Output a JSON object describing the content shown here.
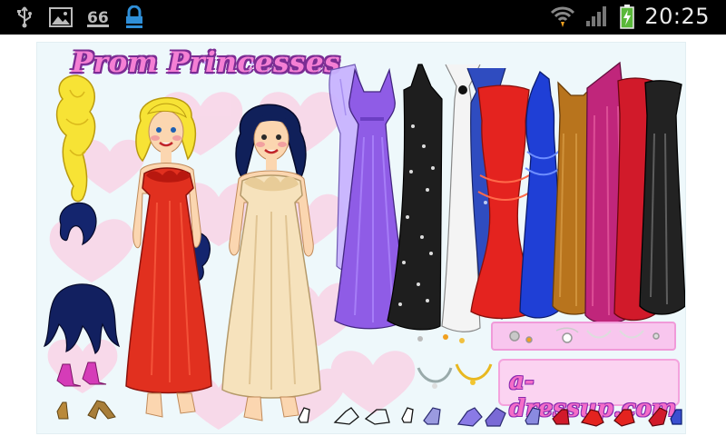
{
  "status_bar": {
    "time": "20:25",
    "left_icons": [
      "usb-icon",
      "image-icon",
      "sixtysix-icon",
      "lock-icon"
    ],
    "right_icons": [
      "wifi-icon",
      "signal-icon",
      "battery-charging-icon"
    ]
  },
  "game": {
    "title": "Prom Princesses",
    "site_logo": "a-dressup.com",
    "colors": {
      "background": "#eef8fb",
      "title_fill": "#f47fd4",
      "title_outline": "#7b2c93",
      "heart": "#f9d4e6",
      "logo_panel": "#fbd3f1"
    },
    "models": [
      "blonde-model",
      "brunette-model"
    ],
    "dress_colors": [
      "#b59bff",
      "#8f5ce6",
      "#1d1d1d",
      "#f4f4f4",
      "#2f4cc0",
      "#e4231f",
      "#1f3fd6",
      "#b8741d",
      "#c0267b",
      "#d11a2a",
      "#222222"
    ],
    "shoe_count": 14,
    "necklace_count": 5
  }
}
